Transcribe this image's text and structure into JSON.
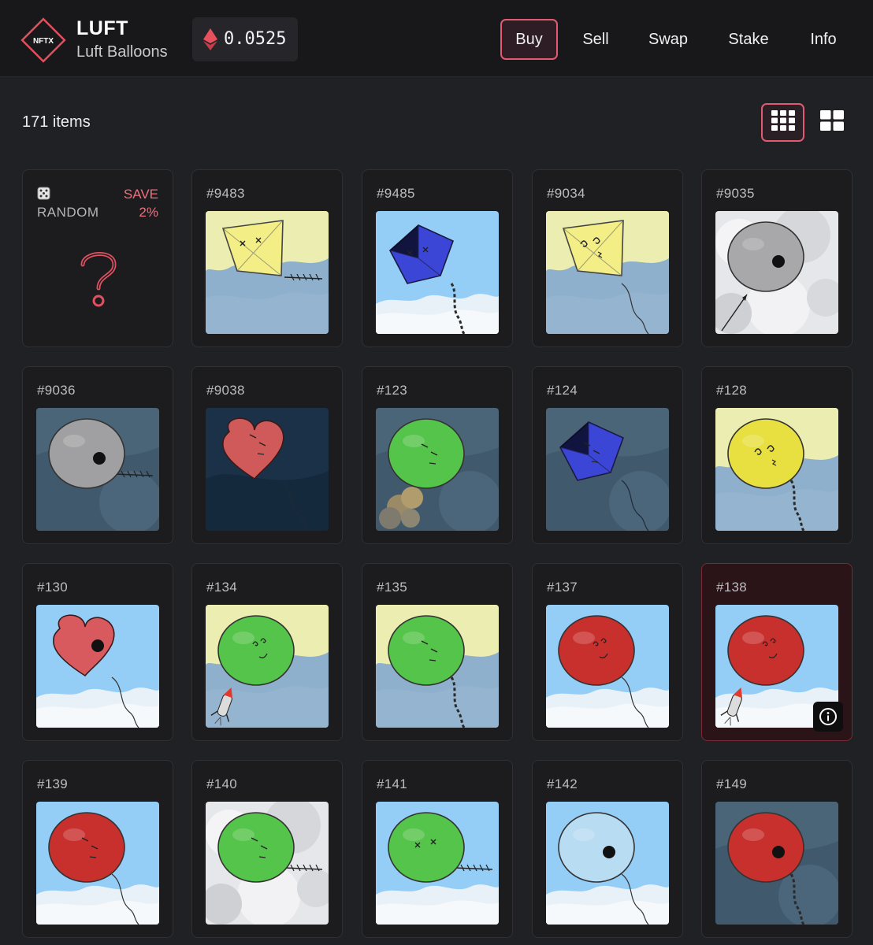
{
  "header": {
    "logo_text": "NFTX",
    "title": "LUFT",
    "subtitle": "Luft Balloons",
    "price": "0.0525",
    "price_icon": "ethereum-icon"
  },
  "nav": {
    "tabs": [
      {
        "label": "Buy",
        "active": true
      },
      {
        "label": "Sell",
        "active": false
      },
      {
        "label": "Swap",
        "active": false
      },
      {
        "label": "Stake",
        "active": false
      },
      {
        "label": "Info",
        "active": false
      }
    ]
  },
  "toolbar": {
    "items_count": "171 items",
    "view_small_icon": "grid-small-icon",
    "view_large_icon": "grid-large-icon",
    "active_view": "small"
  },
  "random_card": {
    "icon": "dice-icon",
    "label": "RANDOM",
    "save_label": "SAVE",
    "save_pct": "2%",
    "icon_center": "question-mark-icon"
  },
  "colors": {
    "accent": "#e05a72",
    "background": "#202124",
    "header_bg": "#18181a",
    "card_bg": "#1c1c1f"
  },
  "items": [
    {
      "id": "#9483",
      "shape": "kite",
      "color": "#f3ee85",
      "bg": "sky-yellow",
      "face": "x-eyes",
      "extra": "fish"
    },
    {
      "id": "#9485",
      "shape": "cube",
      "color": "#3b46d6",
      "bg": "light-sky",
      "face": "x-eyes",
      "extra": "chain"
    },
    {
      "id": "#9034",
      "shape": "kite",
      "color": "#f3ee85",
      "bg": "sky-yellow",
      "face": "dizzy",
      "extra": "string"
    },
    {
      "id": "#9035",
      "shape": "round",
      "color": "#a8a8aa",
      "bg": "cloudy",
      "face": "dot",
      "extra": "arrow"
    },
    {
      "id": "#9036",
      "shape": "round",
      "color": "#a0a0a2",
      "bg": "dark-slate",
      "face": "dot",
      "extra": "fish"
    },
    {
      "id": "#9038",
      "shape": "heart",
      "color": "#d05a5a",
      "bg": "night",
      "face": "sleepy",
      "extra": "string"
    },
    {
      "id": "#123",
      "shape": "round",
      "color": "#55c44a",
      "bg": "dark-slate",
      "face": "sleepy",
      "extra": "cloud"
    },
    {
      "id": "#124",
      "shape": "cube",
      "color": "#3b46d6",
      "bg": "dark-slate",
      "face": "sleepy",
      "extra": "string"
    },
    {
      "id": "#128",
      "shape": "round",
      "color": "#e8e040",
      "bg": "sky-yellow",
      "face": "dizzy",
      "extra": "chain"
    },
    {
      "id": "#130",
      "shape": "heart",
      "color": "#d85a5e",
      "bg": "light-sky",
      "face": "dot",
      "extra": "string"
    },
    {
      "id": "#134",
      "shape": "round",
      "color": "#55c44a",
      "bg": "sky-yellow",
      "face": "smile",
      "extra": "rocket"
    },
    {
      "id": "#135",
      "shape": "round",
      "color": "#55c44a",
      "bg": "sky-yellow",
      "face": "sleepy",
      "extra": "chain"
    },
    {
      "id": "#137",
      "shape": "round",
      "color": "#c8302e",
      "bg": "light-sky",
      "face": "smile",
      "extra": "string"
    },
    {
      "id": "#138",
      "shape": "round",
      "color": "#c8302e",
      "bg": "light-sky",
      "face": "smile",
      "extra": "rocket",
      "selected": true
    },
    {
      "id": "#139",
      "shape": "round",
      "color": "#c8302e",
      "bg": "light-sky",
      "face": "sleepy",
      "extra": "string"
    },
    {
      "id": "#140",
      "shape": "round",
      "color": "#55c44a",
      "bg": "cloudy",
      "face": "sleepy",
      "extra": "fish"
    },
    {
      "id": "#141",
      "shape": "round",
      "color": "#55c44a",
      "bg": "light-sky",
      "face": "x-eyes",
      "extra": "fish"
    },
    {
      "id": "#142",
      "shape": "round",
      "color": "#b8dcf2",
      "bg": "light-sky",
      "face": "dot",
      "extra": "string"
    },
    {
      "id": "#149",
      "shape": "round",
      "color": "#c8302e",
      "bg": "dark-slate",
      "face": "dot",
      "extra": "chain"
    }
  ]
}
